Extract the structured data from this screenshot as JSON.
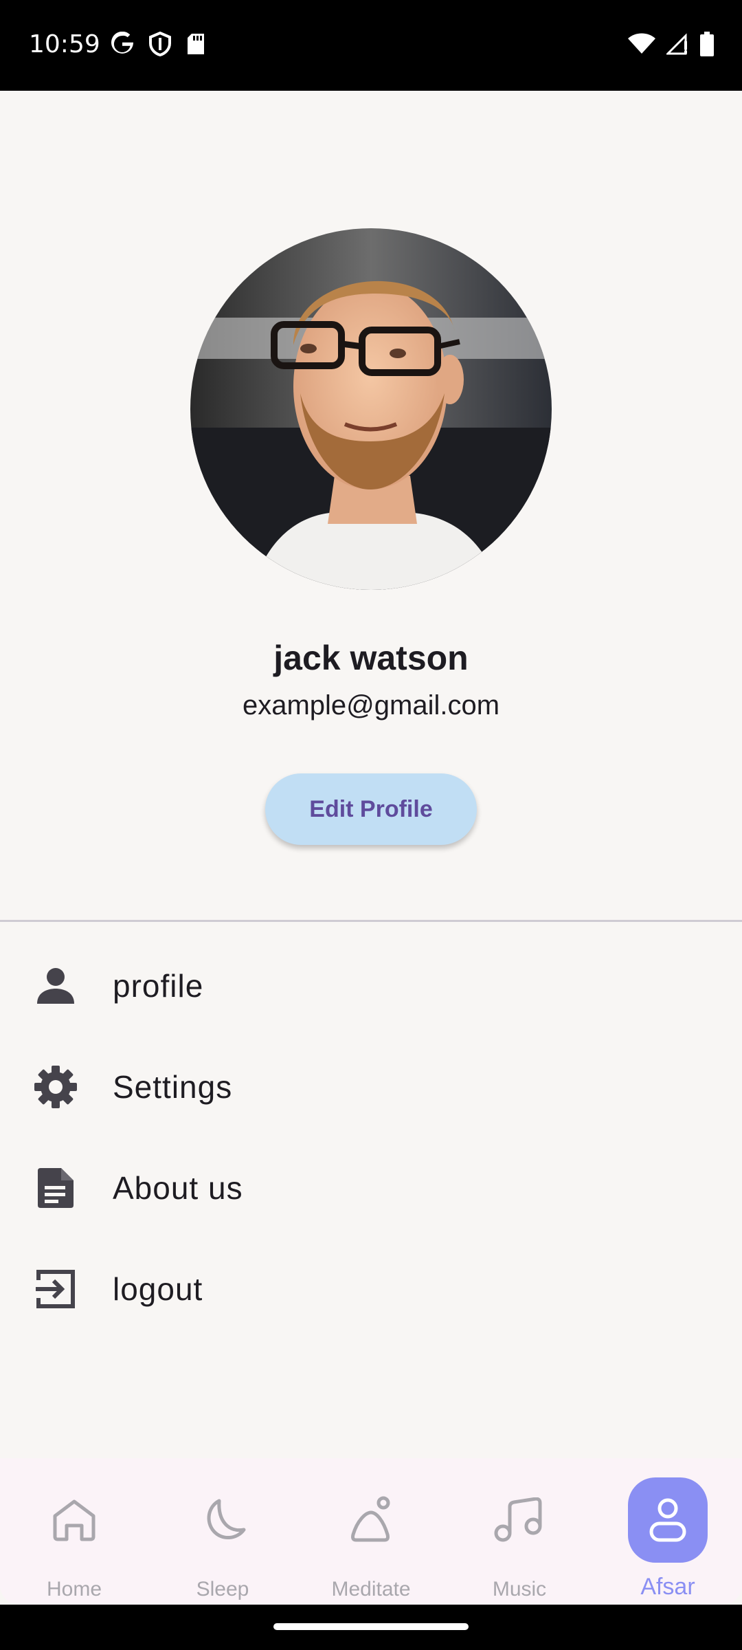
{
  "status_bar": {
    "time": "10:59",
    "left_icons": [
      "google-icon",
      "shield-icon",
      "sd-card-icon"
    ],
    "right_icons": [
      "wifi-icon",
      "signal-icon",
      "battery-icon"
    ]
  },
  "profile": {
    "name": "jack watson",
    "email": "example@gmail.com",
    "edit_button": "Edit Profile",
    "avatar_icon": "profile-photo"
  },
  "menu": [
    {
      "label": "profile",
      "icon": "person-icon"
    },
    {
      "label": "Settings",
      "icon": "gear-icon"
    },
    {
      "label": "About us",
      "icon": "document-icon"
    },
    {
      "label": "logout",
      "icon": "logout-icon"
    }
  ],
  "bottom_nav": [
    {
      "label": "Home",
      "icon": "home-icon",
      "active": false
    },
    {
      "label": "Sleep",
      "icon": "moon-icon",
      "active": false
    },
    {
      "label": "Meditate",
      "icon": "meditate-icon",
      "active": false
    },
    {
      "label": "Music",
      "icon": "music-icon",
      "active": false
    },
    {
      "label": "Afsar",
      "icon": "account-icon",
      "active": true
    }
  ],
  "colors": {
    "background": "#f8f6f4",
    "edit_button_bg": "#c1def4",
    "edit_button_text": "#5f4b9c",
    "nav_active": "#8a8ff3",
    "nav_inactive": "#a9a7ad"
  }
}
